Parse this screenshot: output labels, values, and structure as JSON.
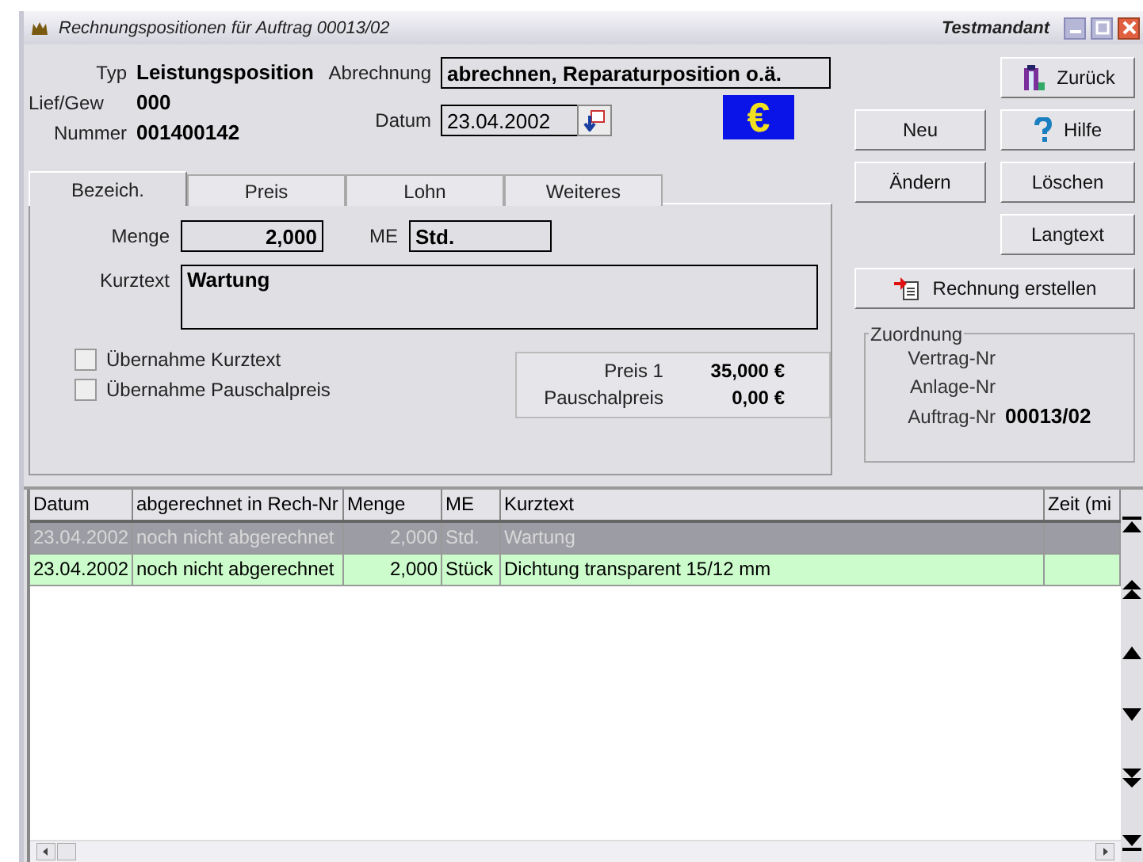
{
  "window": {
    "title": "Rechnungspositionen für Auftrag 00013/02",
    "client": "Testmandant"
  },
  "header": {
    "fields": [
      {
        "label": "Typ",
        "value": "Leistungsposition"
      },
      {
        "label": "Lief/Gew",
        "value": "000"
      },
      {
        "label": "Nummer",
        "value": "001400142"
      }
    ],
    "abrechnung_label": "Abrechnung",
    "abrechnung": "abrechnen, Reparaturposition o.ä.",
    "datum_label": "Datum",
    "datum": "23.04.2002",
    "currency": "€"
  },
  "tabs": [
    {
      "label": "Bezeich.",
      "selected": true
    },
    {
      "label": "Preis",
      "selected": false
    },
    {
      "label": "Lohn",
      "selected": false
    },
    {
      "label": "Weiteres",
      "selected": false
    }
  ],
  "panel": {
    "menge_label": "Menge",
    "menge": "2,000",
    "me_label": "ME",
    "me": "Std.",
    "kurztext_label": "Kurztext",
    "kurztext": "Wartung",
    "checkboxes": [
      {
        "label": "Übernahme Kurztext",
        "checked": false
      },
      {
        "label": "Übernahme Pauschalpreis",
        "checked": false
      }
    ],
    "prices": [
      {
        "label": "Preis 1",
        "value": "35,000 €"
      },
      {
        "label": "Pauschalpreis",
        "value": "0,00 €"
      }
    ]
  },
  "buttons": [
    {
      "label": "Zurück",
      "kind": "right"
    },
    {
      "label": "Neu",
      "kind": "left"
    },
    {
      "label": "Hilfe",
      "kind": "right"
    },
    {
      "label": "Ändern",
      "kind": "left"
    },
    {
      "label": "Löschen",
      "kind": "right"
    },
    {
      "label": "Langtext",
      "kind": "right"
    },
    {
      "label": "Rechnung erstellen",
      "kind": "wide"
    }
  ],
  "zuordnung": {
    "title": "Zuordnung",
    "rows": [
      {
        "label": "Vertrag-Nr"
      },
      {
        "label": "Anlage-Nr"
      },
      {
        "label": "Auftrag-Nr",
        "value": "00013/02"
      }
    ]
  },
  "table": {
    "columns": [
      "Datum",
      "abgerechnet in Rech-Nr",
      "Menge",
      "ME",
      "Kurztext",
      "Zeit (mi"
    ],
    "rows": [
      {
        "selected": true,
        "cells": [
          "23.04.2002",
          "noch nicht abgerechnet",
          "2,000",
          "Std.",
          "Wartung",
          ""
        ]
      },
      {
        "selected": false,
        "cells": [
          "23.04.2002",
          "noch nicht abgerechnet",
          "2,000",
          "Stück",
          "Dichtung transparent 15/12 mm",
          ""
        ]
      }
    ]
  }
}
